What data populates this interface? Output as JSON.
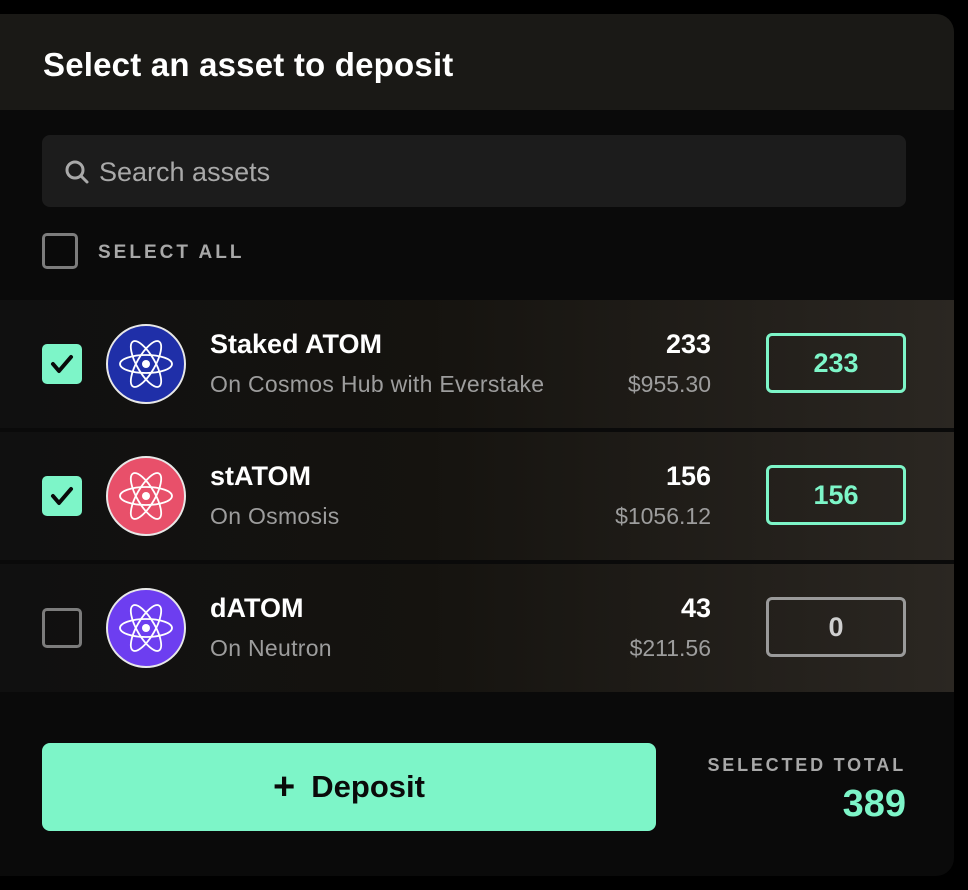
{
  "modal": {
    "title": "Select an asset to deposit"
  },
  "search": {
    "placeholder": "Search assets",
    "icon": "search-icon"
  },
  "select_all": {
    "label": "SELECT ALL",
    "checked": false
  },
  "assets": [
    {
      "name": "Staked ATOM",
      "location": "On Cosmos Hub with Everstake",
      "balance": "233",
      "usd": "$955.30",
      "amount": "233",
      "selected": true,
      "logo_color": "#1f2fa8",
      "icon": "atom-icon"
    },
    {
      "name": "stATOM",
      "location": "On Osmosis",
      "balance": "156",
      "usd": "$1056.12",
      "amount": "156",
      "selected": true,
      "logo_color": "#e8506a",
      "icon": "atom-icon"
    },
    {
      "name": "dATOM",
      "location": "On Neutron",
      "balance": "43",
      "usd": "$211.56",
      "amount": "0",
      "selected": false,
      "logo_color": "#6d3ef0",
      "icon": "atom-icon"
    }
  ],
  "footer": {
    "deposit_label": "Deposit",
    "deposit_icon": "plus-icon",
    "total_label": "SELECTED TOTAL",
    "total_value": "389"
  },
  "colors": {
    "accent": "#7df5c8",
    "background": "#0a0a0a",
    "header": "#1a1916"
  }
}
